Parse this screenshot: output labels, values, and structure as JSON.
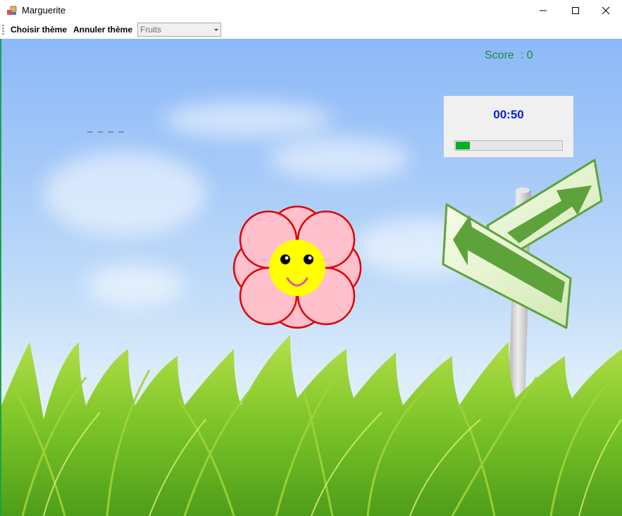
{
  "window": {
    "title": "Marguerite",
    "icon": "app-window-icon",
    "controls": [
      "minimize-icon",
      "maximize-icon",
      "close-icon"
    ]
  },
  "menu": {
    "choose_theme": "Choisir thème",
    "cancel_theme": "Annuler thème",
    "theme_combo": {
      "selected": "Fruits"
    }
  },
  "game": {
    "score_label": "Score  : 0",
    "timer": "00:50",
    "progress_fraction": 0.13,
    "word_blanks": "_ _ _ _",
    "colors": {
      "score": "#1f8a3b",
      "timer": "#0b1fd6",
      "progress": "#06b025",
      "petal_fill": "#ffc0cb",
      "petal_stroke": "#e00000",
      "flower_center": "#ffff00",
      "blanks": "#8a1d6b"
    },
    "icons": [
      "daisy-flower-icon",
      "road-sign-icon",
      "grass-icon"
    ]
  }
}
